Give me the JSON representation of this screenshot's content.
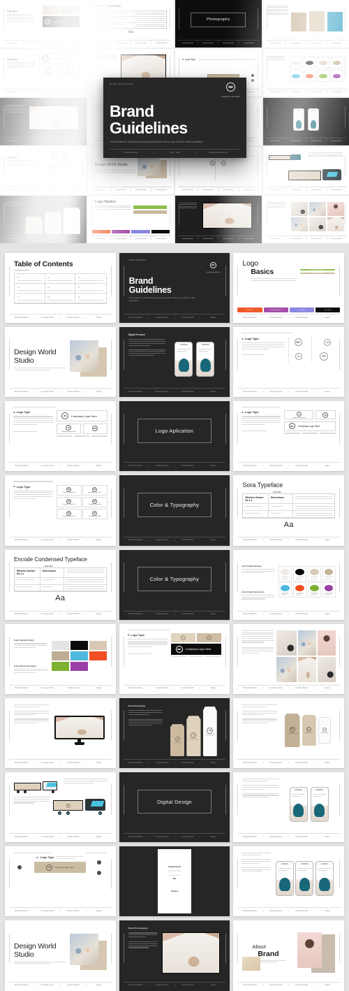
{
  "hero": {
    "eyebrow": "Design World Studio",
    "logo_label": "Company Logo Here",
    "title_line1": "Brand",
    "title_line2": "Guidelines",
    "subtitle": "This template is a multi-purpose and general specific custom, user-oriented, media competitive.",
    "footer": [
      "Brand Guidelines",
      "2021 - 2022",
      "designworldstudio.com"
    ]
  },
  "hero_tiles": [
    {
      "kind": "logotype",
      "title": "Logo Type"
    },
    {
      "kind": "typeface",
      "title": "Sora Typeface"
    },
    {
      "kind": "section",
      "title": "Photography"
    },
    {
      "kind": "bags",
      "title": ""
    },
    {
      "kind": "logoblock",
      "title": "Logo Type"
    },
    {
      "kind": "photo-rack",
      "title": ""
    },
    {
      "kind": "logotype",
      "title": "Logo Type"
    },
    {
      "kind": "ellipses",
      "title": ""
    },
    {
      "kind": "monitor-dark",
      "title": ""
    },
    {
      "kind": "plain",
      "title": ""
    },
    {
      "kind": "phones-dark",
      "title": ""
    },
    {
      "kind": "phones-dark2",
      "title": ""
    },
    {
      "kind": "logotype",
      "title": "Logo Type"
    },
    {
      "kind": "about",
      "title": "Design World Studio"
    },
    {
      "kind": "logotype",
      "title": "Logo Type"
    },
    {
      "kind": "truck",
      "title": ""
    },
    {
      "kind": "pouches",
      "title": ""
    },
    {
      "kind": "logobasics",
      "title": "Logo Basics"
    },
    {
      "kind": "photo-rack-dark",
      "title": ""
    },
    {
      "kind": "collage",
      "title": ""
    }
  ],
  "footer_labels": [
    "Brand Guidelines",
    "Company Name",
    "Creative Studio",
    "Pages"
  ],
  "slides": [
    {
      "id": "table-of-contents",
      "theme": "light",
      "layout": "toc",
      "title": "Table of Contents",
      "items": [
        {
          "num": "01",
          "label": "Logo Basics and Guide"
        },
        {
          "num": "02",
          "label": "Logo Application Area"
        },
        {
          "num": "03",
          "label": "Color and Typography"
        },
        {
          "num": "04",
          "label": "Brand Stationery Kit"
        },
        {
          "num": "05",
          "label": "Digital Design System"
        },
        {
          "num": "06",
          "label": "About Brand Studio"
        },
        {
          "num": "07",
          "label": "Photography Styles"
        },
        {
          "num": "08",
          "label": "Packaging Mockups"
        },
        {
          "num": "09",
          "label": "Contact Information"
        }
      ]
    },
    {
      "id": "cover",
      "theme": "dark",
      "layout": "cover",
      "eyebrow": "Design World Studio",
      "logo_label": "Company Logo Here",
      "title_line1": "Brand",
      "title_line2": "Guidelines",
      "subtitle": "This template is a multi-purpose and general specific custom, user-oriented, media competitive."
    },
    {
      "id": "logo-basics",
      "theme": "light",
      "layout": "logo-basics",
      "title_top": "Logo",
      "title_bottom": "Basics",
      "swatches_right": [
        {
          "label": "Logo Type Secondary",
          "color": "#8cbf49"
        },
        {
          "label": "Logo Type Primary",
          "color": "#c9b99b"
        }
      ],
      "swatches_bottom": [
        {
          "label": "Logo Type",
          "color": "#f05a28"
        },
        {
          "label": "Company Name",
          "color": "#a44fa8"
        },
        {
          "label": "Logo Type",
          "color": "#8b88e0"
        },
        {
          "label": "Logo Type",
          "color": "#0d0d0d"
        }
      ]
    },
    {
      "id": "design-world-studio-1",
      "theme": "light",
      "layout": "about",
      "title_line1": "Design World",
      "title_line2": "Studio"
    },
    {
      "id": "mobile-app-dark",
      "theme": "dark",
      "layout": "phones-2",
      "heading": "Digital Product"
    },
    {
      "id": "logo-grid-light",
      "theme": "light",
      "layout": "logo-grid",
      "label": "Logo Type"
    },
    {
      "id": "logo-type-boxes",
      "theme": "light",
      "layout": "logo-boxes",
      "label": "Logo Type",
      "card_label": "Company Logo Here"
    },
    {
      "id": "logo-application-divider",
      "theme": "dark",
      "layout": "divider",
      "title": "Logo Aplication"
    },
    {
      "id": "logo-application-light",
      "theme": "light",
      "layout": "logo-apply",
      "label": "Logo Type",
      "card_label": "Company Logo Here"
    },
    {
      "id": "logo-six-grid",
      "theme": "light",
      "layout": "logo-six",
      "label": "Logo Type",
      "tile_label": "Company Logo Here"
    },
    {
      "id": "color-typography-divider-1",
      "theme": "dark",
      "layout": "divider",
      "title": "Color & Typography"
    },
    {
      "id": "sora-typeface",
      "theme": "light",
      "layout": "typeface",
      "title": "Sora Typeface",
      "col_head": "Font Size",
      "cells": [
        "Wireless Sensor No 1.1",
        "Dimensions",
        "Dimension Brand",
        "Sora Regular",
        "Sora Bold"
      ],
      "sample": "Aa"
    },
    {
      "id": "encode-condensed-typeface",
      "theme": "light",
      "layout": "typeface",
      "title": "Encode Condensed Typeface",
      "col_head": "Font Size",
      "cells": [
        "Wireless Sensor No 1.1",
        "Dimensions",
        "Dimension Brand",
        "Encode Regular",
        "Encode Bold"
      ],
      "sample": "Aa"
    },
    {
      "id": "color-typography-divider-2",
      "theme": "dark",
      "layout": "divider",
      "title": "Color & Typography"
    },
    {
      "id": "color-ellipses",
      "theme": "light",
      "layout": "color-ellipses",
      "group1": "Color Palette Primary",
      "group2": "Color Palette Secondary",
      "colors": [
        {
          "name": "Warm White",
          "hex": "#efece6"
        },
        {
          "name": "Pure Black",
          "hex": "#0b0b0b"
        },
        {
          "name": "Light Sand",
          "hex": "#d9cbb6"
        },
        {
          "name": "Warm Taupe",
          "hex": "#c5b49a"
        },
        {
          "name": "Sky Blue",
          "hex": "#4fb8dd"
        },
        {
          "name": "Vivid Orange",
          "hex": "#f04e23"
        },
        {
          "name": "Olive Green",
          "hex": "#7db132"
        },
        {
          "name": "Deep Purple",
          "hex": "#9a3fa6"
        }
      ]
    },
    {
      "id": "color-blocks",
      "theme": "light",
      "layout": "color-blocks",
      "group1": "Color Palette Primary",
      "group2": "Color Palette Secondary",
      "colors": [
        {
          "name": "Light Gray",
          "hex": "#e4e4e4"
        },
        {
          "name": "Pure Black",
          "hex": "#0b0b0b"
        },
        {
          "name": "Light Sand",
          "hex": "#d8c8b4"
        },
        {
          "name": "Warm Taupe",
          "hex": "#bfae96"
        },
        {
          "name": "Sky Blue",
          "hex": "#4fb8dd"
        },
        {
          "name": "Vivid Orange",
          "hex": "#f04e23"
        },
        {
          "name": "Olive Green",
          "hex": "#7db132"
        },
        {
          "name": "Deep Purple",
          "hex": "#9a3fa6"
        }
      ]
    },
    {
      "id": "logo-stationery",
      "theme": "light",
      "layout": "stationery",
      "label": "Logo Type",
      "card_label": "Company Logo Here"
    },
    {
      "id": "photography-collage",
      "theme": "light",
      "layout": "collage"
    },
    {
      "id": "monitor-mockup",
      "theme": "light",
      "layout": "monitor"
    },
    {
      "id": "packaging-dark",
      "theme": "dark",
      "layout": "pouches-dark",
      "heading": "Brand Packaging"
    },
    {
      "id": "packaging-light",
      "theme": "light",
      "layout": "pouches-light"
    },
    {
      "id": "vehicle-branding",
      "theme": "light",
      "layout": "trucks"
    },
    {
      "id": "digital-design-divider",
      "theme": "dark",
      "layout": "divider",
      "title": "Digital Design"
    },
    {
      "id": "phones-two-light",
      "theme": "light",
      "layout": "phones-2-light"
    },
    {
      "id": "logo-placement",
      "theme": "light",
      "layout": "logo-placement",
      "label": "Logo Type",
      "card_label": "Company Logo Here"
    },
    {
      "id": "poster-dark",
      "theme": "dark",
      "layout": "poster",
      "poster_title": "Company Inc",
      "poster_sub": "EST. 2021 - 2022",
      "poster_body": "Title",
      "poster_addr": "Address"
    },
    {
      "id": "phones-three-light",
      "theme": "light",
      "layout": "phones-3"
    },
    {
      "id": "design-world-studio-2",
      "theme": "light",
      "layout": "about",
      "title_line1": "Design World",
      "title_line2": "Studio"
    },
    {
      "id": "photo-feature-dark",
      "theme": "dark",
      "layout": "photo-feature",
      "heading": "Brand Photography"
    },
    {
      "id": "about-brand",
      "theme": "light",
      "layout": "about-brand",
      "title_top": "About",
      "title_bottom": "Brand"
    }
  ]
}
